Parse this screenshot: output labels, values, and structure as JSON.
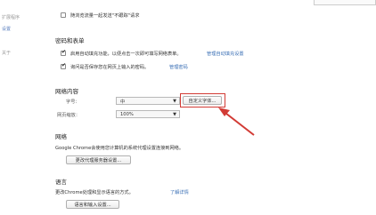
{
  "sidebar": {
    "items": [
      {
        "label": "扩展程序"
      },
      {
        "label": "设置"
      },
      {
        "label": "关于"
      }
    ]
  },
  "privacy": {
    "dnt_label": "随浏览流量一起发送\"不跟踪\"请求",
    "dnt_checked": false
  },
  "passwords": {
    "heading": "密码和表单",
    "autofill_label": "启用自动填充功能，以便点击一次即可填写网络表单。",
    "autofill_link": "管理自动填充设置",
    "autofill_checked": true,
    "save_pw_label": "询问是否保存您在网页上输入的密码。",
    "save_pw_link": "管理密码",
    "save_pw_checked": true
  },
  "web_content": {
    "heading": "网络内容",
    "font_label": "字号：",
    "font_value": "中",
    "customize_fonts_button": "自定义字体...",
    "zoom_label": "网页缩放：",
    "zoom_value": "100%"
  },
  "network": {
    "heading": "网络",
    "description": "Google Chrome会使用您计算机的系统代理设置连接到网络。",
    "proxy_button": "更改代理服务器设置..."
  },
  "language": {
    "heading": "语言",
    "description": "更改Chrome处理和显示语言的方式。",
    "learn_more": "了解详情",
    "language_button": "语言和输入设置..."
  },
  "annotation": {
    "highlight_color": "#d23b35"
  }
}
